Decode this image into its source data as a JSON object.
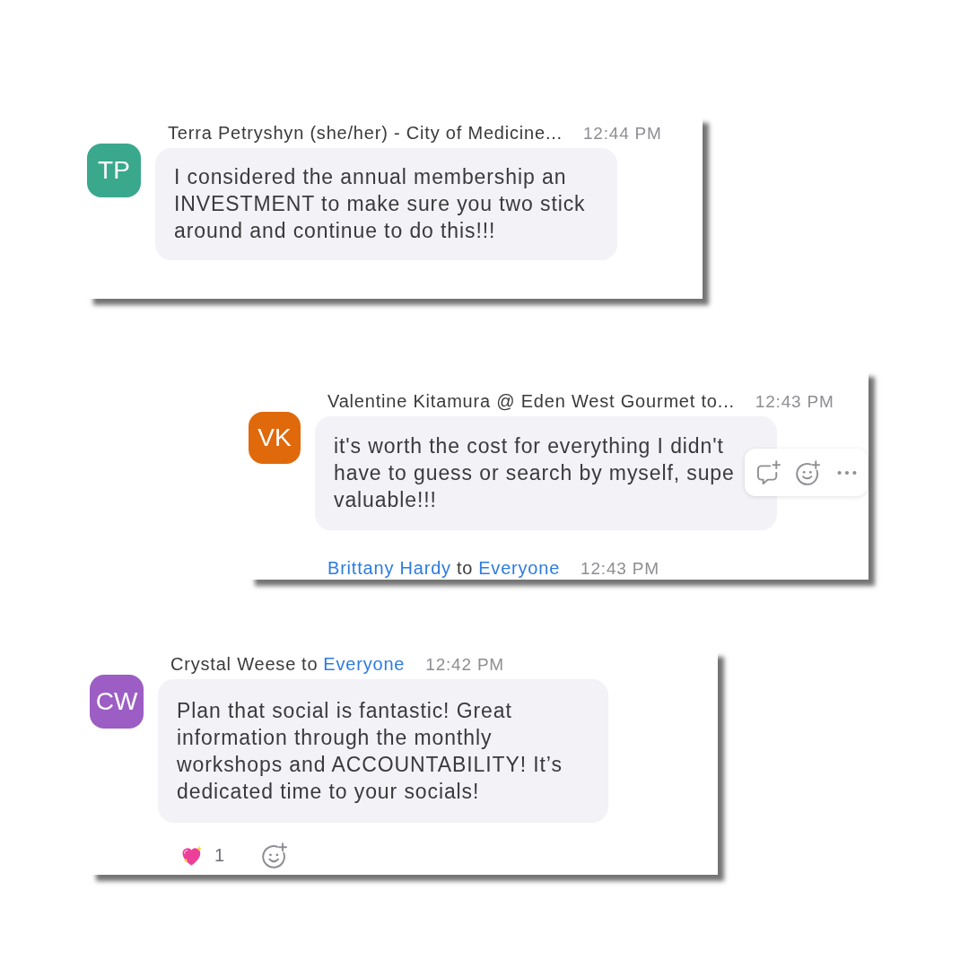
{
  "snippets": [
    {
      "initials": "TP",
      "color": "#3aa88c",
      "header": {
        "sender": {
          "text": "Terra Petryshyn (she/her) - City of Medicine...",
          "link": false
        }
      },
      "time": "12:44 PM",
      "text": "I considered the annual membership an\nINVESTMENT to make sure you two stick\naround and continue to do this!!!"
    },
    {
      "initials": "VK",
      "color": "#e0690b",
      "header": {
        "sender": {
          "text": "Valentine Kitamura @ Eden West Gourmet to...",
          "link": false
        }
      },
      "time": "12:43 PM",
      "text": "it's worth the cost for everything I didn't\nhave to guess or search by myself, supe\nvaluable!!!",
      "actions": [
        {
          "kind": "reply"
        },
        {
          "kind": "react"
        },
        {
          "kind": "more"
        }
      ],
      "next_header": {
        "sender": {
          "text": "Brittany Hardy",
          "link": true
        },
        "connector": "to",
        "recipient": {
          "text": "Everyone",
          "link": true
        },
        "time": "12:43 PM"
      }
    },
    {
      "initials": "CW",
      "color": "#9c5dc4",
      "header": {
        "sender": {
          "text": "Crystal Weese",
          "link": false
        },
        "connector": "to",
        "recipient": {
          "text": "Everyone",
          "link": true
        }
      },
      "time": "12:42 PM",
      "text": "Plan that social is fantastic! Great\ninformation through the monthly\nworkshops and ACCOUNTABILITY! It’s\ndedicated time to your socials!",
      "reactions": [
        {
          "kind": "sparkling-heart",
          "count": "1"
        }
      ],
      "add_reaction": true
    }
  ]
}
